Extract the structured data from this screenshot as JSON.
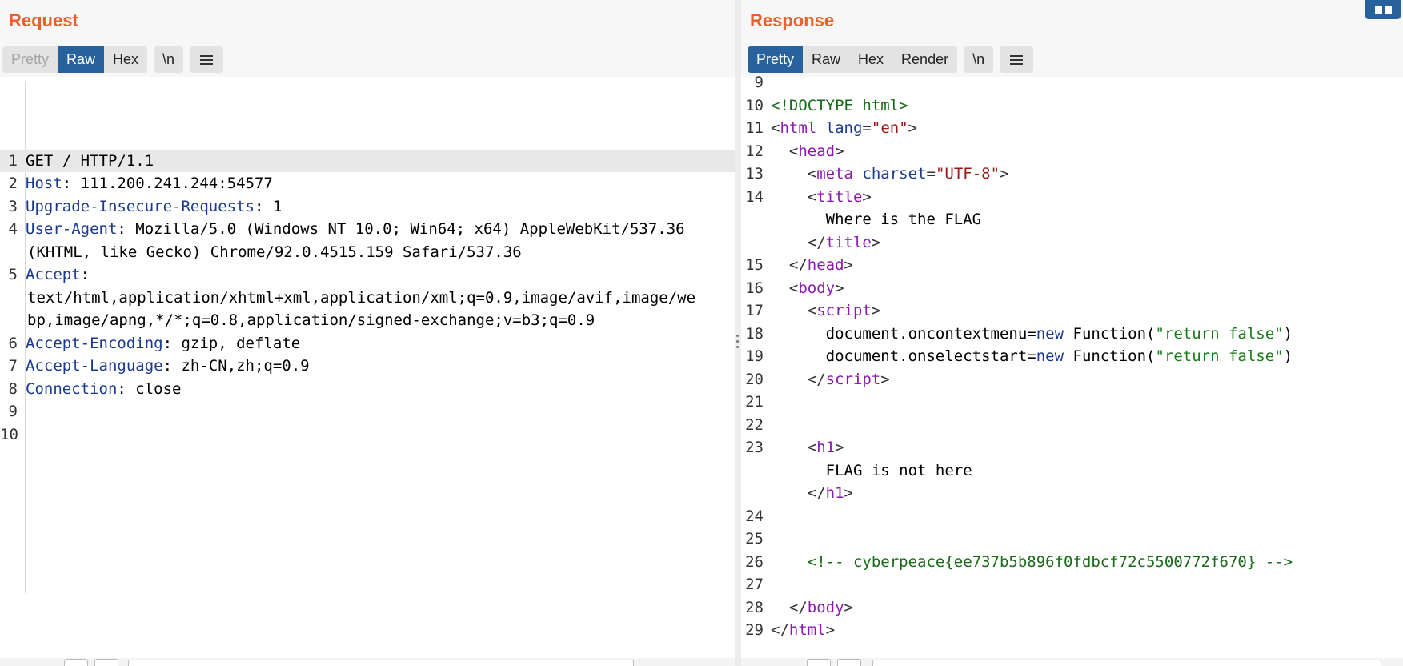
{
  "request": {
    "title": "Request",
    "tabs": [
      {
        "label": "Pretty",
        "state": "disabled"
      },
      {
        "label": "Raw",
        "state": "active"
      },
      {
        "label": "Hex",
        "state": "normal"
      }
    ],
    "newline_toggle": "\\n",
    "menu_icon": "hamburger-menu-icon",
    "lines": [
      {
        "num": "1",
        "key": "",
        "value": "GET / HTTP/1.1"
      },
      {
        "num": "2",
        "key": "Host",
        "value": ": 111.200.241.244:54577"
      },
      {
        "num": "3",
        "key": "Upgrade-Insecure-Requests",
        "value": ": 1"
      },
      {
        "num": "4",
        "key": "User-Agent",
        "value": ": Mozilla/5.0 (Windows NT 10.0; Win64; x64) AppleWebKit/537.36",
        "cont": [
          "(KHTML, like Gecko) Chrome/92.0.4515.159 Safari/537.36"
        ]
      },
      {
        "num": "5",
        "key": "Accept",
        "value": ":",
        "cont": [
          "text/html,application/xhtml+xml,application/xml;q=0.9,image/avif,image/we",
          "bp,image/apng,*/*;q=0.8,application/signed-exchange;v=b3;q=0.9"
        ]
      },
      {
        "num": "6",
        "key": "Accept-Encoding",
        "value": ": gzip, deflate"
      },
      {
        "num": "7",
        "key": "Accept-Language",
        "value": ": zh-CN,zh;q=0.9"
      },
      {
        "num": "8",
        "key": "Connection",
        "value": ": close"
      },
      {
        "num": "9",
        "key": "",
        "value": ""
      },
      {
        "num": "10",
        "key": "",
        "value": ""
      }
    ]
  },
  "response": {
    "title": "Response",
    "tabs": [
      {
        "label": "Pretty",
        "state": "active"
      },
      {
        "label": "Raw",
        "state": "normal"
      },
      {
        "label": "Hex",
        "state": "normal"
      },
      {
        "label": "Render",
        "state": "normal"
      }
    ],
    "newline_toggle": "\\n",
    "menu_icon": "hamburger-menu-icon",
    "lines": [
      {
        "num": "9",
        "segs": []
      },
      {
        "num": "10",
        "segs": [
          {
            "t": "<!DOCTYPE html>",
            "c": "comment"
          }
        ]
      },
      {
        "num": "11",
        "segs": [
          {
            "t": "<",
            "c": "punct"
          },
          {
            "t": "html ",
            "c": "tag"
          },
          {
            "t": "lang",
            "c": "attr"
          },
          {
            "t": "=",
            "c": "punct"
          },
          {
            "t": "\"en\"",
            "c": "str"
          },
          {
            "t": ">",
            "c": "punct"
          }
        ]
      },
      {
        "num": "12",
        "segs": [
          {
            "t": "  <",
            "c": "punct"
          },
          {
            "t": "head",
            "c": "tag"
          },
          {
            "t": ">",
            "c": "punct"
          }
        ]
      },
      {
        "num": "13",
        "segs": [
          {
            "t": "    <",
            "c": "punct"
          },
          {
            "t": "meta ",
            "c": "tag"
          },
          {
            "t": "charset",
            "c": "attr"
          },
          {
            "t": "=",
            "c": "punct"
          },
          {
            "t": "\"UTF-8\"",
            "c": "str"
          },
          {
            "t": ">",
            "c": "punct"
          }
        ]
      },
      {
        "num": "14",
        "segs": [
          {
            "t": "    <",
            "c": "punct"
          },
          {
            "t": "title",
            "c": "tag"
          },
          {
            "t": ">",
            "c": "punct"
          }
        ]
      },
      {
        "num": "",
        "segs": [
          {
            "t": "      Where is the FLAG",
            "c": "text"
          }
        ]
      },
      {
        "num": "",
        "segs": [
          {
            "t": "    </",
            "c": "punct"
          },
          {
            "t": "title",
            "c": "tag"
          },
          {
            "t": ">",
            "c": "punct"
          }
        ]
      },
      {
        "num": "15",
        "segs": [
          {
            "t": "  </",
            "c": "punct"
          },
          {
            "t": "head",
            "c": "tag"
          },
          {
            "t": ">",
            "c": "punct"
          }
        ]
      },
      {
        "num": "16",
        "segs": [
          {
            "t": "  <",
            "c": "punct"
          },
          {
            "t": "body",
            "c": "tag"
          },
          {
            "t": ">",
            "c": "punct"
          }
        ]
      },
      {
        "num": "17",
        "segs": [
          {
            "t": "    <",
            "c": "punct"
          },
          {
            "t": "script",
            "c": "tag"
          },
          {
            "t": ">",
            "c": "punct"
          }
        ]
      },
      {
        "num": "18",
        "segs": [
          {
            "t": "      document.oncontextmenu=",
            "c": "text"
          },
          {
            "t": "new",
            "c": "js-kw"
          },
          {
            "t": " Function(",
            "c": "text"
          },
          {
            "t": "\"return false\"",
            "c": "js-str"
          },
          {
            "t": ")",
            "c": "text"
          }
        ]
      },
      {
        "num": "19",
        "segs": [
          {
            "t": "      document.onselectstart=",
            "c": "text"
          },
          {
            "t": "new",
            "c": "js-kw"
          },
          {
            "t": " Function(",
            "c": "text"
          },
          {
            "t": "\"return false\"",
            "c": "js-str"
          },
          {
            "t": ")",
            "c": "text"
          }
        ]
      },
      {
        "num": "20",
        "segs": [
          {
            "t": "    </",
            "c": "punct"
          },
          {
            "t": "script",
            "c": "tag"
          },
          {
            "t": ">",
            "c": "punct"
          }
        ]
      },
      {
        "num": "21",
        "segs": []
      },
      {
        "num": "22",
        "segs": []
      },
      {
        "num": "23",
        "segs": [
          {
            "t": "    <",
            "c": "punct"
          },
          {
            "t": "h1",
            "c": "tag"
          },
          {
            "t": ">",
            "c": "punct"
          }
        ]
      },
      {
        "num": "",
        "segs": [
          {
            "t": "      FLAG is not here",
            "c": "text"
          }
        ]
      },
      {
        "num": "",
        "segs": [
          {
            "t": "    </",
            "c": "punct"
          },
          {
            "t": "h1",
            "c": "tag"
          },
          {
            "t": ">",
            "c": "punct"
          }
        ]
      },
      {
        "num": "24",
        "segs": []
      },
      {
        "num": "25",
        "segs": []
      },
      {
        "num": "26",
        "segs": [
          {
            "t": "    <!-- cyberpeace{ee737b5b896f0fdbcf72c5500772f670} -->",
            "c": "comment"
          }
        ]
      },
      {
        "num": "27",
        "segs": []
      },
      {
        "num": "28",
        "segs": [
          {
            "t": "  </",
            "c": "punct"
          },
          {
            "t": "body",
            "c": "tag"
          },
          {
            "t": ">",
            "c": "punct"
          }
        ]
      },
      {
        "num": "29",
        "segs": [
          {
            "t": "</",
            "c": "punct"
          },
          {
            "t": "html",
            "c": "tag"
          },
          {
            "t": ">",
            "c": "punct"
          }
        ]
      }
    ]
  },
  "colors": {
    "accent": "#e8612c",
    "active_tab": "#27629c",
    "header_key": "#1b3a8e",
    "tag": "#8a1ab0",
    "js_string": "#1a7a1a"
  },
  "layout_toggle_icon": "split-view-icon"
}
